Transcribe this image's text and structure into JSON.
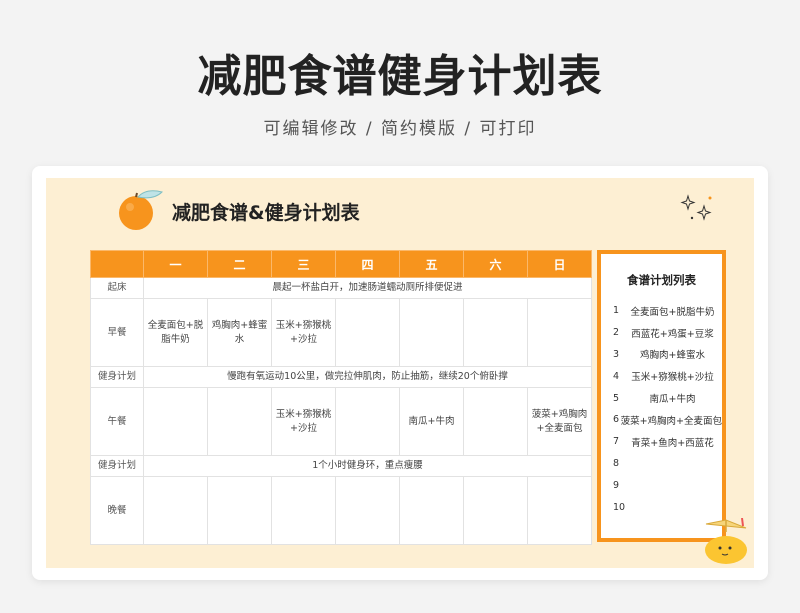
{
  "header": {
    "title": "减肥食谱健身计划表",
    "subtitle": "可编辑修改 / 简约模版 / 可打印"
  },
  "sheet": {
    "title": "减肥食谱&健身计划表"
  },
  "schedule": {
    "days": [
      "一",
      "二",
      "三",
      "四",
      "五",
      "六",
      "日"
    ],
    "rows": {
      "wake": {
        "label": "起床",
        "text": "晨起一杯盐白开，加速肠道蠕动厕所排便促进"
      },
      "breakfast": {
        "label": "早餐",
        "cells": [
          "全麦面包+脱脂牛奶",
          "鸡胸肉+蜂蜜水",
          "玉米+猕猴桃+沙拉",
          "",
          "",
          "",
          ""
        ]
      },
      "fitness1": {
        "label": "健身计划",
        "text": "慢跑有氧运动10公里，做完拉伸肌肉，防止抽筋，继续20个俯卧撑"
      },
      "lunch": {
        "label": "午餐",
        "cells": [
          "",
          "",
          "玉米+猕猴桃+沙拉",
          "",
          "南瓜+牛肉",
          "",
          "菠菜+鸡胸肉+全麦面包"
        ]
      },
      "fitness2": {
        "label": "健身计划",
        "text": "1个小时健身环，重点瘦腰"
      },
      "dinner": {
        "label": "晚餐",
        "cells": [
          "",
          "",
          "",
          "",
          "",
          "",
          ""
        ]
      }
    }
  },
  "recipe_list": {
    "title": "食谱计划列表",
    "items": [
      {
        "num": "1",
        "text": "全麦面包+脱脂牛奶"
      },
      {
        "num": "2",
        "text": "西蓝花+鸡蛋+豆浆"
      },
      {
        "num": "3",
        "text": "鸡胸肉+蜂蜜水"
      },
      {
        "num": "4",
        "text": "玉米+猕猴桃+沙拉"
      },
      {
        "num": "5",
        "text": "南瓜+牛肉"
      },
      {
        "num": "6",
        "text": "菠菜+鸡胸肉+全麦面包"
      },
      {
        "num": "7",
        "text": "青菜+鱼肉+西蓝花"
      },
      {
        "num": "8",
        "text": ""
      },
      {
        "num": "9",
        "text": ""
      },
      {
        "num": "10",
        "text": ""
      }
    ]
  },
  "colors": {
    "accent": "#f7941d",
    "sheet_background": "#fdefd3"
  }
}
